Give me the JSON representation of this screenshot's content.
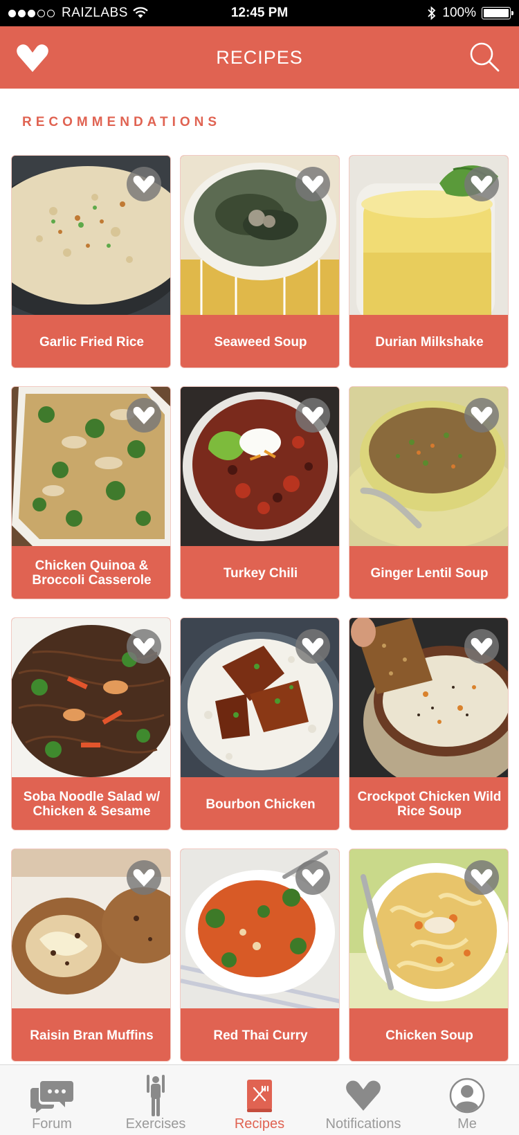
{
  "status_bar": {
    "carrier": "RAIZLABS",
    "time": "12:45 PM",
    "battery": "100%"
  },
  "nav": {
    "title": "RECIPES",
    "logo_icon": "heart-chevron-icon",
    "search_icon": "search-icon"
  },
  "section": {
    "title": "RECOMMENDATIONS"
  },
  "recipes": [
    {
      "name": "Garlic Fried Rice",
      "favorite_icon": "chevron-down-icon"
    },
    {
      "name": "Seaweed Soup",
      "favorite_icon": "chevron-down-icon"
    },
    {
      "name": "Durian Milkshake",
      "favorite_icon": "chevron-down-icon"
    },
    {
      "name": "Chicken Quinoa & Broccoli Casserole",
      "favorite_icon": "chevron-down-icon"
    },
    {
      "name": "Turkey Chili",
      "favorite_icon": "chevron-down-icon"
    },
    {
      "name": "Ginger Lentil Soup",
      "favorite_icon": "chevron-down-icon"
    },
    {
      "name": "Soba Noodle Salad w/ Chicken & Sesame",
      "favorite_icon": "chevron-down-icon"
    },
    {
      "name": "Bourbon Chicken",
      "favorite_icon": "chevron-down-icon"
    },
    {
      "name": "Crockpot Chicken Wild Rice Soup",
      "favorite_icon": "chevron-down-icon"
    },
    {
      "name": "Raisin Bran Muffins",
      "favorite_icon": "chevron-down-icon"
    },
    {
      "name": "Red Thai Curry",
      "favorite_icon": "chevron-down-icon"
    },
    {
      "name": "Chicken Soup",
      "favorite_icon": "chevron-down-icon"
    }
  ],
  "tabs": [
    {
      "label": "Forum",
      "icon": "chat-bubbles-icon",
      "active": false
    },
    {
      "label": "Exercises",
      "icon": "person-stretch-icon",
      "active": false
    },
    {
      "label": "Recipes",
      "icon": "recipe-book-icon",
      "active": true
    },
    {
      "label": "Notifications",
      "icon": "heart-chevron-icon",
      "active": false
    },
    {
      "label": "Me",
      "icon": "profile-icon",
      "active": false
    }
  ],
  "colors": {
    "brand": "#e06352",
    "tab_inactive": "#9a9a9a",
    "status_bar": "#000000"
  }
}
